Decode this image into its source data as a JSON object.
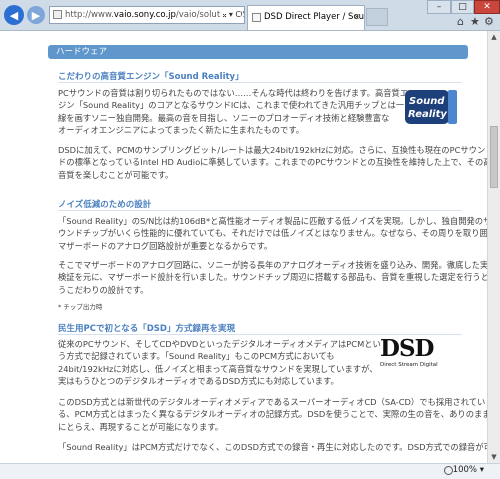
{
  "browser": {
    "address_prefix": "http://www.",
    "address_domain": "vaio.sony.co.jp",
    "address_rest": "/vaio/solution/DSD/",
    "address_tools": "𝄪 ▾ C",
    "tab_title": "DSD Direct Player / Sou...",
    "tab_close": "×",
    "minimize": "–",
    "maximize": "□",
    "close": "✕",
    "home_icon": "⌂",
    "favorites_icon": "★",
    "settings_icon": "⚙",
    "zoom_label": "100%",
    "zoom_arrow": "▾"
  },
  "section": {
    "title": "ハードウェア"
  },
  "blocks": [
    {
      "heading": "こだわりの高音質エンジン「Sound Reality」",
      "lines": [
        "PCサウンドの音質は割り切られたものではない……そんな時代は終わりを告げます。高音質エン",
        "ジン「Sound Reality」のコアとなるサウンドICは、これまで使われてきた汎用チップとは一",
        "線を画すソニー独自開発。最高の音を目指し、ソニーのプロオーディオ技術と経験豊富な",
        "オーディオエンジニアによってまったく新たに生まれたものです。"
      ],
      "lines2": [
        "DSDに加えて、PCMのサンプリングビット/レートは最大24bit/192kHzに対応。さらに、互換性も現在のPCサウン",
        "ドの標準となっているIntel HD Audioに準拠しています。これまでのPCサウンドとの互換性を維持した上で、その高",
        "音質を楽しむことが可能です。"
      ]
    },
    {
      "heading": "ノイズ低減のための設計",
      "lines": [
        "「Sound Reality」のS/N比は約106dB*と高性能オーディオ製品に匹敵する低ノイズを実現。しかし、独自開発のサ",
        "ウンドチップがいくら性能的に優れていても、それだけでは低ノイズとはなりません。なぜなら、その周りを取り囲む",
        "マザーボードのアナログ回路設計が重要となるからです。"
      ],
      "lines2": [
        "そこでマザーボードのアナログ回路に、ソニーが誇る長年のアナログオーディオ技術を盛り込み、開発。徹底した実験",
        "検証を元に、マザーボード設計を行いました。サウンドチップ周辺に搭載する部品も、音質を重視した選定を行うとい",
        "うこだわりの設計です。"
      ],
      "note": "* チップ出力時"
    },
    {
      "heading": "民生用PCで初となる「DSD」方式録再を実現",
      "lines": [
        "従来のPCサウンド、そしてCDやDVDといったデジタルオーディオメディアはPCMとい",
        "う方式で記録されています。「Sound Reality」もこのPCM方式においても",
        "24bit/192kHzに対応し、低ノイズと相まって高音質なサウンドを実現していますが、",
        "実はもうひとつのデジタルオーディオであるDSD方式にも対応しています。"
      ],
      "lines2": [
        "このDSD方式とは新世代のデジタルオーディオメディアであるスーパーオーディオCD（SA-CD）でも採用されてい",
        "る、PCM方式とはまったく異なるデジタルオーディオの記録方式。DSDを使うことで、実際の生の音を、ありのまま",
        "にとらえ、再現することが可能になります。"
      ],
      "lines3": [
        "「Sound Reality」はPCM方式だけでなく、このDSD方式での録音・再生に対応したのです。DSD方式での録音が可"
      ]
    }
  ],
  "logos": {
    "sound_reality_line1": "Sound",
    "sound_reality_line2": "Reality",
    "dsd_big": "DSD",
    "dsd_small": "Direct Stream Digital"
  },
  "colors": {
    "accent": "#4b80bf",
    "section_bar": "#5f97cc"
  }
}
